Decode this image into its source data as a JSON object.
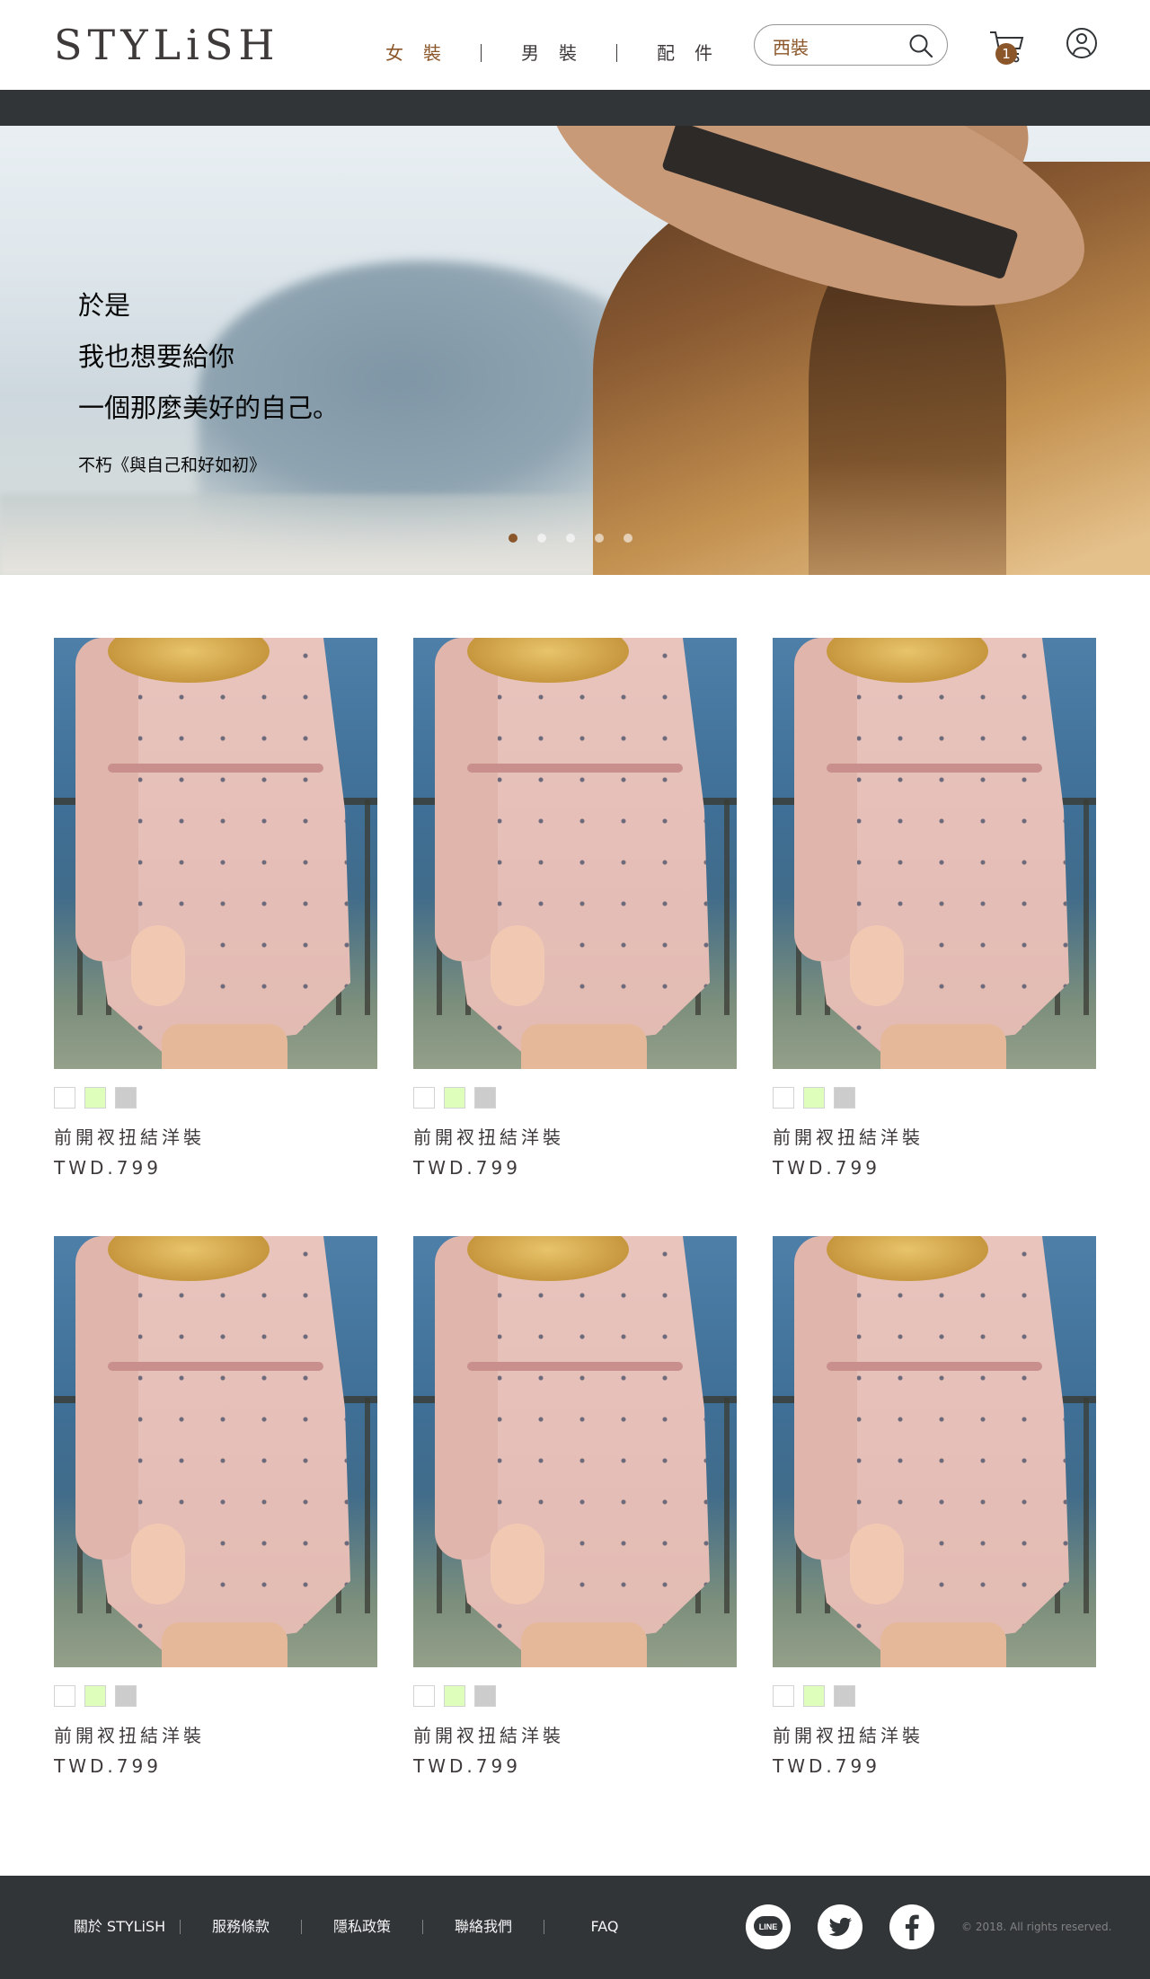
{
  "header": {
    "logo": "STYLiSH",
    "nav": [
      {
        "label": "女裝",
        "active": true
      },
      {
        "label": "男裝",
        "active": false
      },
      {
        "label": "配件",
        "active": false
      }
    ],
    "search": {
      "value": "西裝",
      "icon": "search-icon"
    },
    "cart": {
      "icon": "cart-icon",
      "count": "1"
    },
    "member": {
      "icon": "member-icon"
    }
  },
  "hero": {
    "lines": [
      "於是",
      "我也想要給你",
      "一個那麼美好的自己。"
    ],
    "source": "不朽《與自己和好如初》",
    "dots": 5,
    "active_dot": 1
  },
  "products": [
    {
      "name": "前開衩扭結洋裝",
      "price": "TWD.799",
      "colors": [
        "#FFFFFF",
        "#DDFFBB",
        "#CCCCCC"
      ]
    },
    {
      "name": "前開衩扭結洋裝",
      "price": "TWD.799",
      "colors": [
        "#FFFFFF",
        "#DDFFBB",
        "#CCCCCC"
      ]
    },
    {
      "name": "前開衩扭結洋裝",
      "price": "TWD.799",
      "colors": [
        "#FFFFFF",
        "#DDFFBB",
        "#CCCCCC"
      ]
    },
    {
      "name": "前開衩扭結洋裝",
      "price": "TWD.799",
      "colors": [
        "#FFFFFF",
        "#DDFFBB",
        "#CCCCCC"
      ]
    },
    {
      "name": "前開衩扭結洋裝",
      "price": "TWD.799",
      "colors": [
        "#FFFFFF",
        "#DDFFBB",
        "#CCCCCC"
      ]
    },
    {
      "name": "前開衩扭結洋裝",
      "price": "TWD.799",
      "colors": [
        "#FFFFFF",
        "#DDFFBB",
        "#CCCCCC"
      ]
    }
  ],
  "footer": {
    "links": [
      "關於 STYLiSH",
      "服務條款",
      "隱私政策",
      "聯絡我們",
      "FAQ"
    ],
    "social": [
      {
        "icon": "line-icon",
        "label": "LINE"
      },
      {
        "icon": "twitter-icon"
      },
      {
        "icon": "facebook-icon"
      }
    ],
    "copyright": "© 2018. All rights reserved."
  },
  "colors": {
    "accent": "#8B572A",
    "dark": "#313538",
    "text": "#3F3A3A"
  }
}
